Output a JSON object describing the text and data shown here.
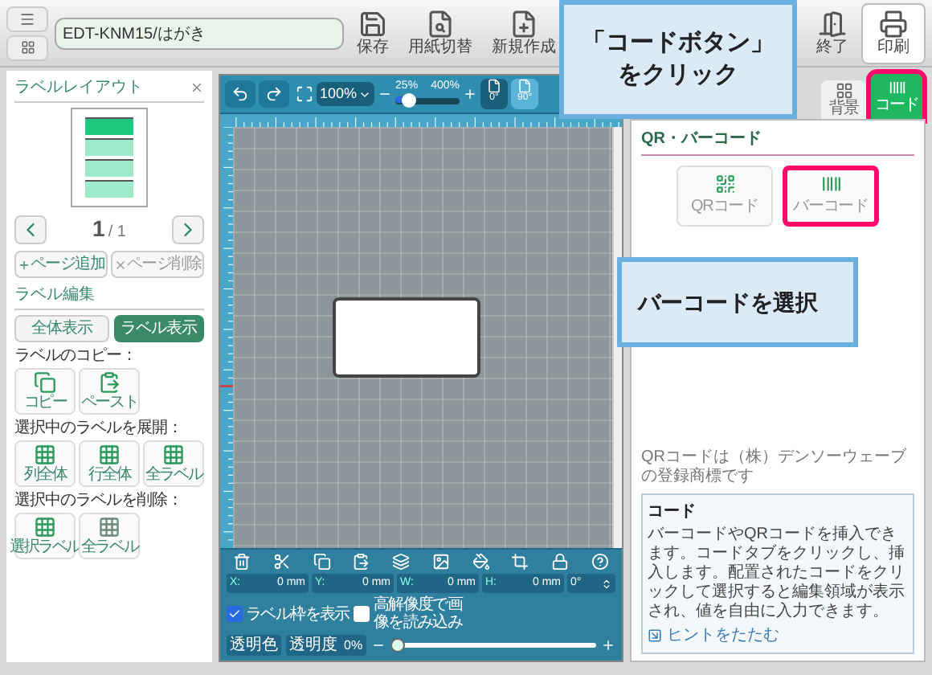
{
  "file_field": {
    "value": "EDT-KNM15/はがき"
  },
  "toolbar": [
    {
      "kind": "save",
      "label": "保存"
    },
    {
      "kind": "paper",
      "label": "用紙切替"
    },
    {
      "kind": "new",
      "label": "新規作成"
    },
    {
      "kind": "exit",
      "label": "終了"
    },
    {
      "kind": "print",
      "label": "印刷"
    }
  ],
  "left_panel": {
    "title": "ラベルレイアウト",
    "layout": [
      {
        "selected": true
      },
      {
        "selected": false
      },
      {
        "selected": false
      },
      {
        "selected": false
      }
    ],
    "page": "1",
    "page_total": "/ 1",
    "add_page": "ページ追加",
    "delete_page": "ページ削除",
    "edit_title": "ラベル編集",
    "view_buttons": [
      {
        "label": "全体表示",
        "selected": false
      },
      {
        "label": "ラベル表示",
        "selected": true
      }
    ],
    "groups": [
      {
        "title": "ラベルのコピー：",
        "tools": [
          {
            "kind": "copy",
            "label": "コピー"
          },
          {
            "kind": "paste",
            "label": "ペースト"
          }
        ]
      },
      {
        "title": "選択中のラベルを展開：",
        "tools": [
          {
            "kind": "column",
            "label": "列全体"
          },
          {
            "kind": "row",
            "label": "行全体"
          },
          {
            "kind": "all",
            "label": "全ラベル"
          }
        ]
      },
      {
        "title": "選択中のラベルを削除：",
        "tools": [
          {
            "kind": "selected",
            "label": "選択ラベル"
          },
          {
            "kind": "all",
            "label": "全ラベル"
          }
        ]
      }
    ]
  },
  "canvas_toolbar": {
    "zoom": "100%",
    "zoom_min": "25%",
    "zoom_max": "400%",
    "level": 0.2,
    "rotations": [
      {
        "label": "0°",
        "selected": true
      },
      {
        "label": "90°",
        "selected": false
      }
    ]
  },
  "bottom_toolbar": {
    "fields": [
      {
        "label": "X:",
        "value": "0",
        "unit": "mm"
      },
      {
        "label": "Y:",
        "value": "0",
        "unit": "mm"
      },
      {
        "label": "W:",
        "value": "0",
        "unit": "mm"
      },
      {
        "label": "H:",
        "value": "0",
        "unit": "mm"
      }
    ],
    "angle": "0°",
    "transparent_color": "透明色",
    "show_frame": {
      "label": "ラベル枠を表示",
      "checked": true
    },
    "high_res": {
      "label": "高解像度で画像を読み込み",
      "checked": false
    },
    "opacity": {
      "label": "透明度",
      "value": "0%",
      "level": 0
    }
  },
  "right_panel": {
    "tabs": [
      {
        "label": "背景",
        "selected": false,
        "highlighted": false
      },
      {
        "label": "コード",
        "selected": true,
        "highlighted": true
      }
    ],
    "section_title": "QR・バーコード",
    "code_buttons": [
      {
        "kind": "qr",
        "label": "QRコード",
        "highlighted": false
      },
      {
        "kind": "barcode",
        "label": "バーコード",
        "highlighted": true
      }
    ],
    "footnote": "QRコードは（株）デンソーウェーブの登録商標です",
    "hint": {
      "title": "コード",
      "text": "バーコードやQRコードを挿入できます。コードタブをクリックし、挿入します。配置されたコードをクリックして選択すると編集領域が表示され、値を自由に入力できます。",
      "collapse": "ヒントをたたむ"
    }
  },
  "callouts": [
    {
      "text": "「コードボタン」をクリック"
    },
    {
      "text": "バーコードを選択"
    }
  ]
}
